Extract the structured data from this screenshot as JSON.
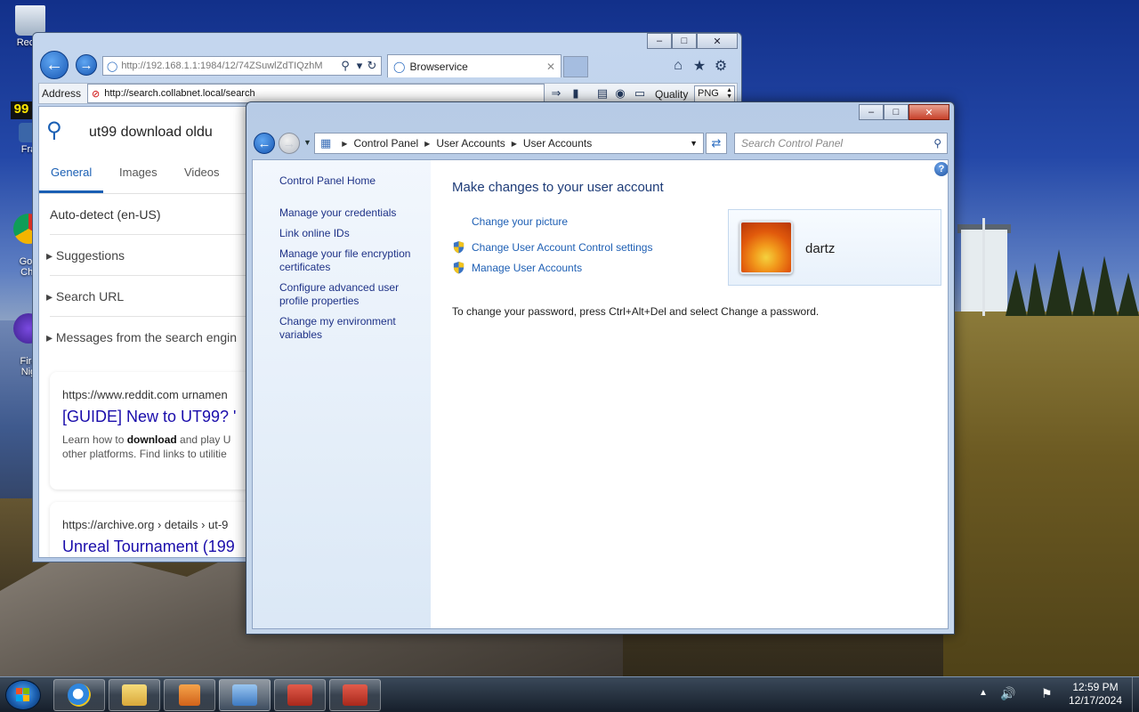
{
  "desktop": {
    "icons": [
      {
        "label": "Recyc"
      },
      {
        "label": "Fra"
      },
      {
        "label": "Goo\nChr"
      },
      {
        "label": "Fire\nNig"
      }
    ],
    "badge": "99"
  },
  "ie": {
    "url_address": "http://192.168.1.1:1984/12/74ZSuwlZdTIQzhM",
    "url_host_highlight": "192.168.1.1",
    "tab_title": "Browservice",
    "address_label": "Address",
    "address_value": "http://search.collabnet.local/search",
    "quality_label": "Quality",
    "quality_value": "PNG",
    "page": {
      "search_query": "ut99 download oldu",
      "tabs": [
        "General",
        "Images",
        "Videos"
      ],
      "region": "Auto-detect (en-US)",
      "sections": [
        "Suggestions",
        "Search URL",
        "Messages from the search engin"
      ],
      "results": [
        {
          "url": "https://www.reddit.com  urnamen",
          "title": "[GUIDE] New to UT99? '",
          "snippet_pre": "Learn how to ",
          "snippet_bold": "download",
          "snippet_post": " and play U",
          "snippet_line2": "other platforms. Find links to utilitie"
        },
        {
          "url": "https://archive.org  › details › ut-9",
          "title": "Unreal Tournament (199"
        }
      ]
    }
  },
  "control_panel": {
    "breadcrumb": [
      "Control Panel",
      "User Accounts",
      "User Accounts"
    ],
    "search_placeholder": "Search Control Panel",
    "sidebar": {
      "home": "Control Panel Home",
      "links": [
        "Manage your credentials",
        "Link online IDs",
        "Manage your file encryption certificates",
        "Configure advanced user profile properties",
        "Change my environment variables"
      ]
    },
    "heading": "Make changes to your user account",
    "actions": {
      "change_picture": "Change your picture",
      "uac": "Change User Account Control settings",
      "manage": "Manage User Accounts"
    },
    "user_name": "dartz",
    "password_note": "To change your password, press Ctrl+Alt+Del and select Change a password."
  },
  "taskbar": {
    "time": "12:59 PM",
    "date": "12/17/2024"
  },
  "colors": {
    "link": "#1e5fb4",
    "heading": "#1e3c78",
    "accent": "#1a5fb4"
  }
}
